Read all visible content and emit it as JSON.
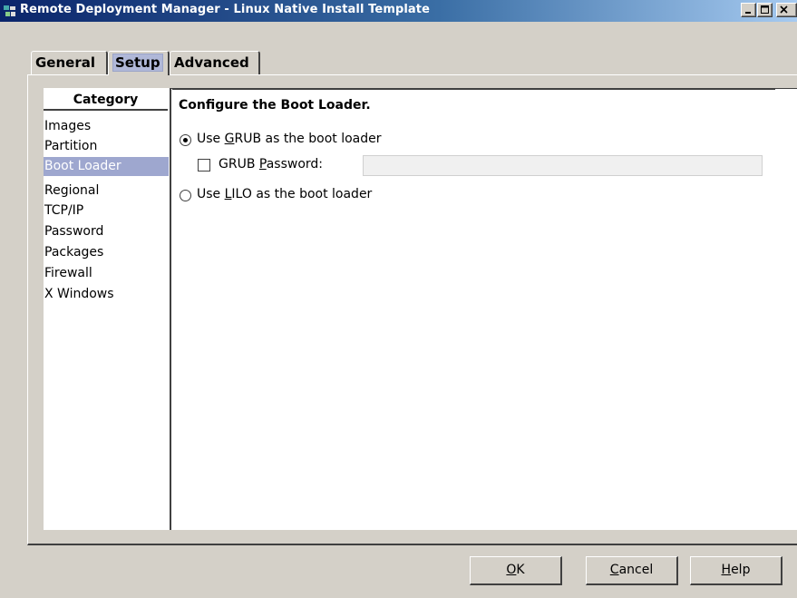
{
  "window": {
    "title": "Remote Deployment Manager - Linux Native Install Template"
  },
  "tabs": [
    {
      "label": "General"
    },
    {
      "label": "Setup"
    },
    {
      "label": "Advanced"
    }
  ],
  "category": {
    "header": "Category",
    "items": [
      {
        "label": "Images"
      },
      {
        "label": "Partition"
      },
      {
        "label": "Boot Loader"
      },
      {
        "label": "Regional"
      },
      {
        "label": "TCP/IP"
      },
      {
        "label": "Password"
      },
      {
        "label": "Packages"
      },
      {
        "label": "Firewall"
      },
      {
        "label": "X Windows"
      }
    ],
    "selected": "Boot Loader"
  },
  "boot_loader": {
    "title": "Configure the Boot Loader.",
    "grub_option": {
      "prefix": "Use ",
      "mnemonic": "G",
      "suffix": "RUB as the boot loader",
      "checked": true
    },
    "grub_password": {
      "prefix": "GRUB ",
      "mnemonic": "P",
      "suffix": "assword:",
      "checked": false,
      "value": ""
    },
    "lilo_option": {
      "prefix": "Use ",
      "mnemonic": "L",
      "suffix": "ILO as the boot loader",
      "checked": false
    }
  },
  "buttons": {
    "ok": {
      "mnemonic": "O",
      "rest": "K"
    },
    "cancel": {
      "mnemonic": "C",
      "rest": "ancel"
    },
    "help": {
      "mnemonic": "H",
      "rest": "elp"
    }
  },
  "colors": {
    "title_gradient_start": "#0a246a",
    "selection": "#9ea7cf",
    "window_bg": "#d4d0c8"
  }
}
